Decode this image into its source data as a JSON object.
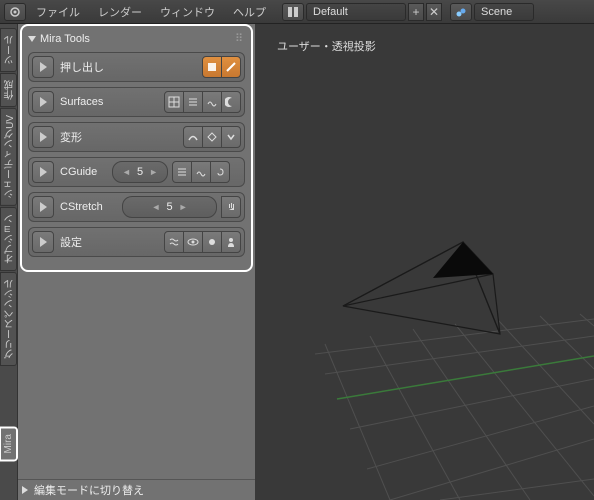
{
  "topbar": {
    "menus": [
      "ファイル",
      "レンダー",
      "ウィンドウ",
      "ヘルプ"
    ],
    "layout_label": "Default",
    "scene_label": "Scene"
  },
  "tabs": [
    "ツール",
    "作成",
    "シェーディングUV",
    "オプション",
    "グリースペンシル",
    "Mira"
  ],
  "mira": {
    "title": "Mira Tools",
    "rows": {
      "extrude": "押し出し",
      "surfaces": "Surfaces",
      "deform": "変形",
      "cguide": "CGuide",
      "cguide_val": "5",
      "cstretch": "CStretch",
      "cstretch_val": "5",
      "settings": "設定"
    }
  },
  "bottom_panel": "編集モードに切り替え",
  "viewport": {
    "label": "ユーザー・透視投影"
  }
}
